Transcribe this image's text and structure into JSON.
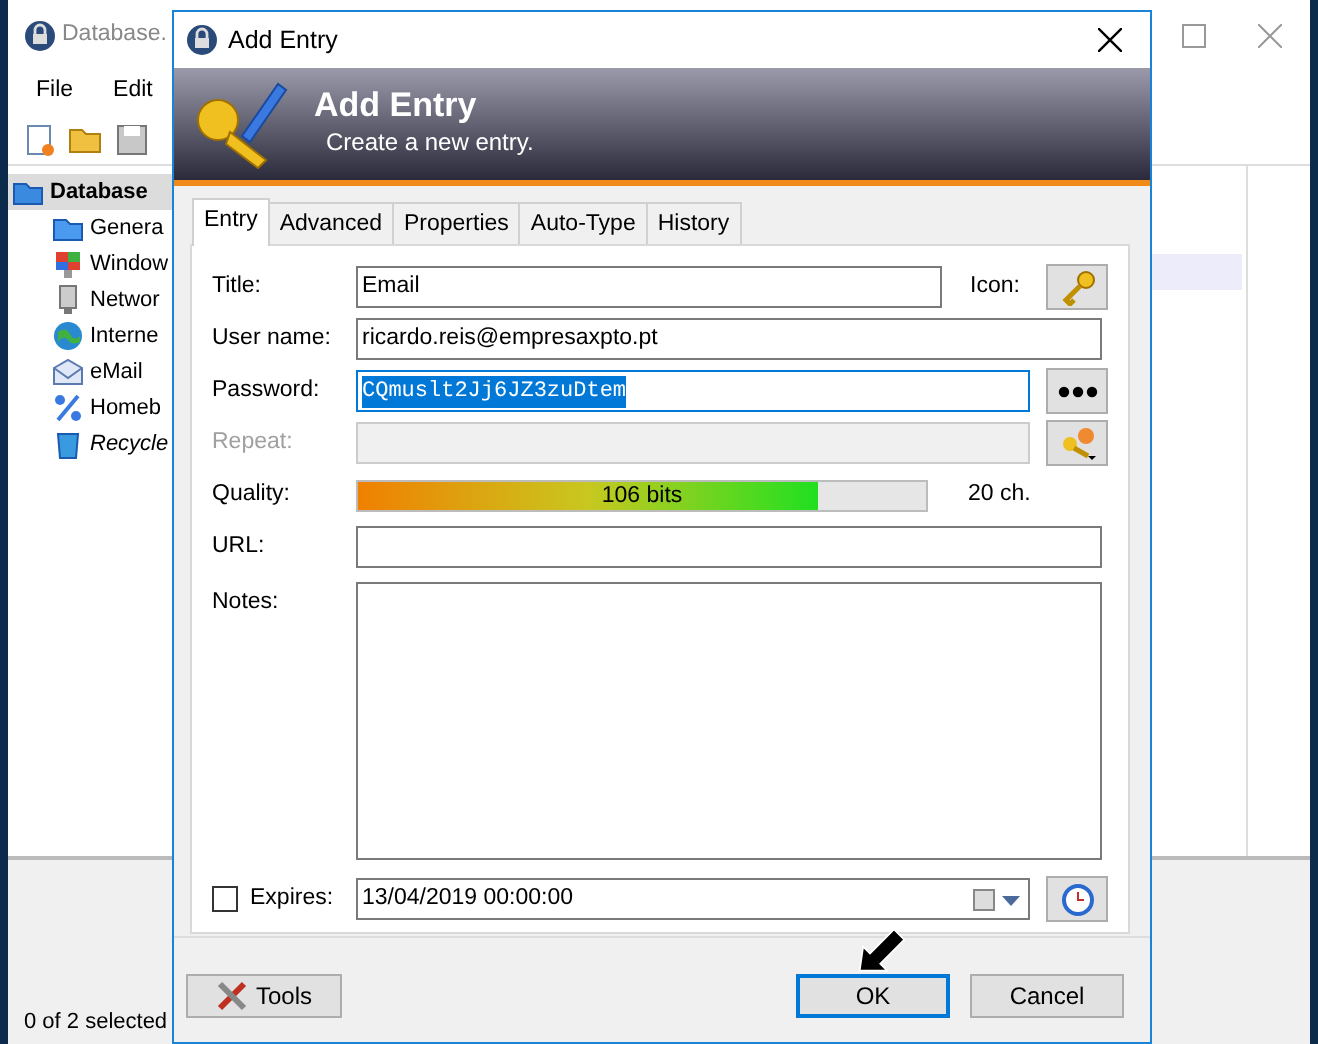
{
  "main_window": {
    "title": "Database.",
    "menu": [
      "File",
      "Edit"
    ],
    "tree": [
      {
        "label": "Database",
        "kind": "database",
        "selected": true,
        "children": [
          {
            "label": "Genera",
            "kind": "folder",
            "selected": false
          },
          {
            "label": "Window",
            "kind": "windows",
            "selected": false
          },
          {
            "label": "Networ",
            "kind": "network",
            "selected": false
          },
          {
            "label": "Interne",
            "kind": "internet",
            "selected": false
          },
          {
            "label": "eMail",
            "kind": "email",
            "selected": false
          },
          {
            "label": "Homeb",
            "kind": "homebanking",
            "selected": false
          },
          {
            "label": "Recycle",
            "kind": "recycle",
            "selected": false
          }
        ]
      }
    ],
    "status_bar": "0 of 2 selected"
  },
  "dialog": {
    "title": "Add Entry",
    "banner": {
      "title": "Add Entry",
      "subtitle": "Create a new entry."
    },
    "tabs": [
      {
        "label": "Entry",
        "selected": true
      },
      {
        "label": "Advanced",
        "selected": false
      },
      {
        "label": "Properties",
        "selected": false
      },
      {
        "label": "Auto-Type",
        "selected": false
      },
      {
        "label": "History",
        "selected": false
      }
    ],
    "title_field": {
      "label": "Title:",
      "value": "Email"
    },
    "icon_label": "Icon:",
    "username": {
      "label": "User name:",
      "value": "ricardo.reis@empresaxpto.pt"
    },
    "password": {
      "label": "Password:",
      "value": "CQmuslt2Jj6JZ3zuDtem",
      "text_selected": true
    },
    "repeat": {
      "label": "Repeat:",
      "disabled": true
    },
    "quality": {
      "label": "Quality:",
      "level": 0.81,
      "reading": "106 bits",
      "length": "20 ch."
    },
    "url": {
      "label": "URL:"
    },
    "notes": {
      "label": "Notes:"
    },
    "expires": {
      "label": "Expires:",
      "checked": false,
      "value": "13/04/2019 00:00:00"
    },
    "buttons": [
      {
        "label": "Tools",
        "kind": "tools",
        "default": false
      },
      {
        "label": "OK",
        "kind": "ok",
        "default": true
      },
      {
        "label": "Cancel",
        "kind": "cancel",
        "default": false
      }
    ]
  }
}
